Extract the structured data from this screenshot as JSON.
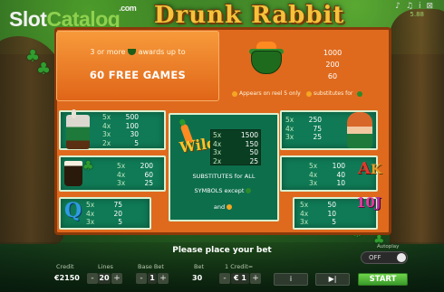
{
  "brand": {
    "part1": "Slot",
    "part2": "Catalog",
    "suffix": ".com"
  },
  "game_title": "Drunk Rabbit",
  "top_icons": {
    "music": "♪",
    "sound": "♫",
    "info": "i",
    "close": "⊠"
  },
  "version": "5.88",
  "bonus": {
    "line1": "3 or more",
    "line1b": "awards up to",
    "big": "60 FREE GAMES",
    "pays": [
      "1000",
      "200",
      "60"
    ],
    "note_reels": "Appears on reel 5 only",
    "note_sub": "substitutes for"
  },
  "symbols": {
    "rabbit": [
      [
        "5x",
        "500"
      ],
      [
        "4x",
        "100"
      ],
      [
        "3x",
        "30"
      ],
      [
        "2x",
        "5"
      ]
    ],
    "girl": [
      [
        "5x",
        "250"
      ],
      [
        "4x",
        "75"
      ],
      [
        "3x",
        "25"
      ]
    ],
    "beer": [
      [
        "5x",
        "200"
      ],
      [
        "4x",
        "60"
      ],
      [
        "3x",
        "25"
      ]
    ],
    "ak": [
      [
        "5x",
        "100"
      ],
      [
        "4x",
        "40"
      ],
      [
        "3x",
        "10"
      ]
    ],
    "q": [
      [
        "5x",
        "75"
      ],
      [
        "4x",
        "20"
      ],
      [
        "3x",
        "5"
      ]
    ],
    "tenj": [
      [
        "5x",
        "50"
      ],
      [
        "4x",
        "10"
      ],
      [
        "3x",
        "5"
      ]
    ]
  },
  "wild": {
    "label": "Wild",
    "pays": [
      [
        "5x",
        "1500"
      ],
      [
        "4x",
        "150"
      ],
      [
        "3x",
        "50"
      ],
      [
        "2x",
        "25"
      ]
    ],
    "sub1": "SUBSTITUTES for ALL",
    "sub2": "SYMBOLS except",
    "sub3": "and"
  },
  "status_message": "Please place your bet",
  "controls": {
    "credit_label": "Credit",
    "credit_value": "€2150",
    "lines_label": "Lines",
    "lines_value": "20",
    "base_bet_label": "Base Bet",
    "base_bet_value": "1",
    "bet_label": "Bet",
    "bet_value": "30",
    "coin_label": "1 Credit=",
    "coin_value": "€ 1",
    "minus": "-",
    "plus": "+",
    "info_btn": "i",
    "skip_btn": "▶|",
    "autoplay_label": "Autoplay",
    "autoplay_state": "OFF",
    "start": "START"
  }
}
